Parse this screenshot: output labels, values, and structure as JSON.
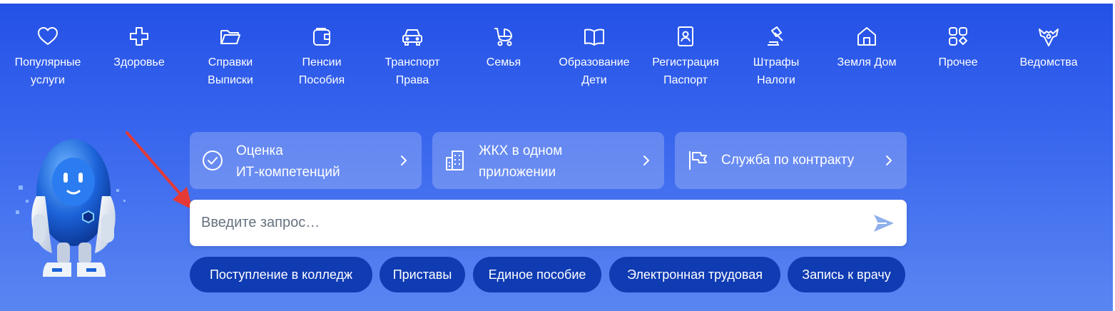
{
  "categories": [
    {
      "label": "Популярные\nуслуги",
      "icon": "heart-icon"
    },
    {
      "label": "Здоровье",
      "icon": "medical-cross-icon"
    },
    {
      "label": "Справки\nВыписки",
      "icon": "folder-icon"
    },
    {
      "label": "Пенсии\nПособия",
      "icon": "wallet-icon"
    },
    {
      "label": "Транспорт\nПрава",
      "icon": "car-icon"
    },
    {
      "label": "Семья",
      "icon": "stroller-icon"
    },
    {
      "label": "Образование\nДети",
      "icon": "book-icon"
    },
    {
      "label": "Регистрация\nПаспорт",
      "icon": "passport-icon"
    },
    {
      "label": "Штрафы\nНалоги",
      "icon": "gavel-icon"
    },
    {
      "label": "Земля Дом",
      "icon": "house-icon"
    },
    {
      "label": "Прочее",
      "icon": "grid-icon"
    },
    {
      "label": "Ведомства",
      "icon": "eagle-emblem-icon"
    }
  ],
  "promos": [
    {
      "label": "Оценка\nИТ-компетенций",
      "icon": "check-circle-icon"
    },
    {
      "label": "ЖКХ в одном\nприложении",
      "icon": "building-icon"
    },
    {
      "label": "Служба по контракту",
      "icon": "flag-icon"
    }
  ],
  "search": {
    "placeholder": "Введите запрос…",
    "value": "",
    "send_icon": "send-arrow-icon"
  },
  "chips": [
    "Поступление в колледж",
    "Приставы",
    "Единое пособие",
    "Электронная трудовая",
    "Запись к врачу"
  ],
  "colors": {
    "hero_top": "#2451e6",
    "hero_bottom": "#5a86f2",
    "chip_bg": "#0f3bb3",
    "annotation_arrow": "#e53935"
  }
}
